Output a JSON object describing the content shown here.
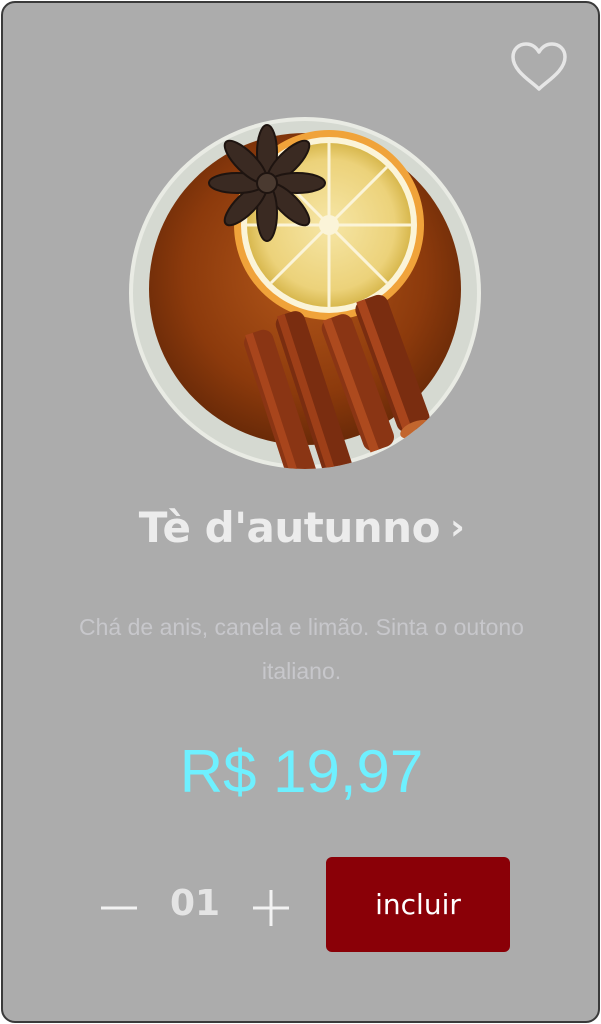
{
  "product": {
    "name": "Tè d'autunno",
    "title_chevron": "›",
    "description": "Chá de anis, canela e limão. Sinta o outono italiano.",
    "price": "R$ 19,97",
    "image_icon": "tea-cup-with-lemon-star-anise-cinnamon"
  },
  "favorite": {
    "icon": "heart-outline-icon"
  },
  "quantity": {
    "value": "01",
    "decrement_icon": "minus-icon",
    "increment_icon": "plus-icon"
  },
  "actions": {
    "add_label": "incluir"
  },
  "colors": {
    "card_background": "#acacac",
    "title": "#ececec",
    "description": "#c7c7cb",
    "price": "#6ef0ff",
    "button": "#8a0007",
    "button_text": "#ffffff"
  }
}
